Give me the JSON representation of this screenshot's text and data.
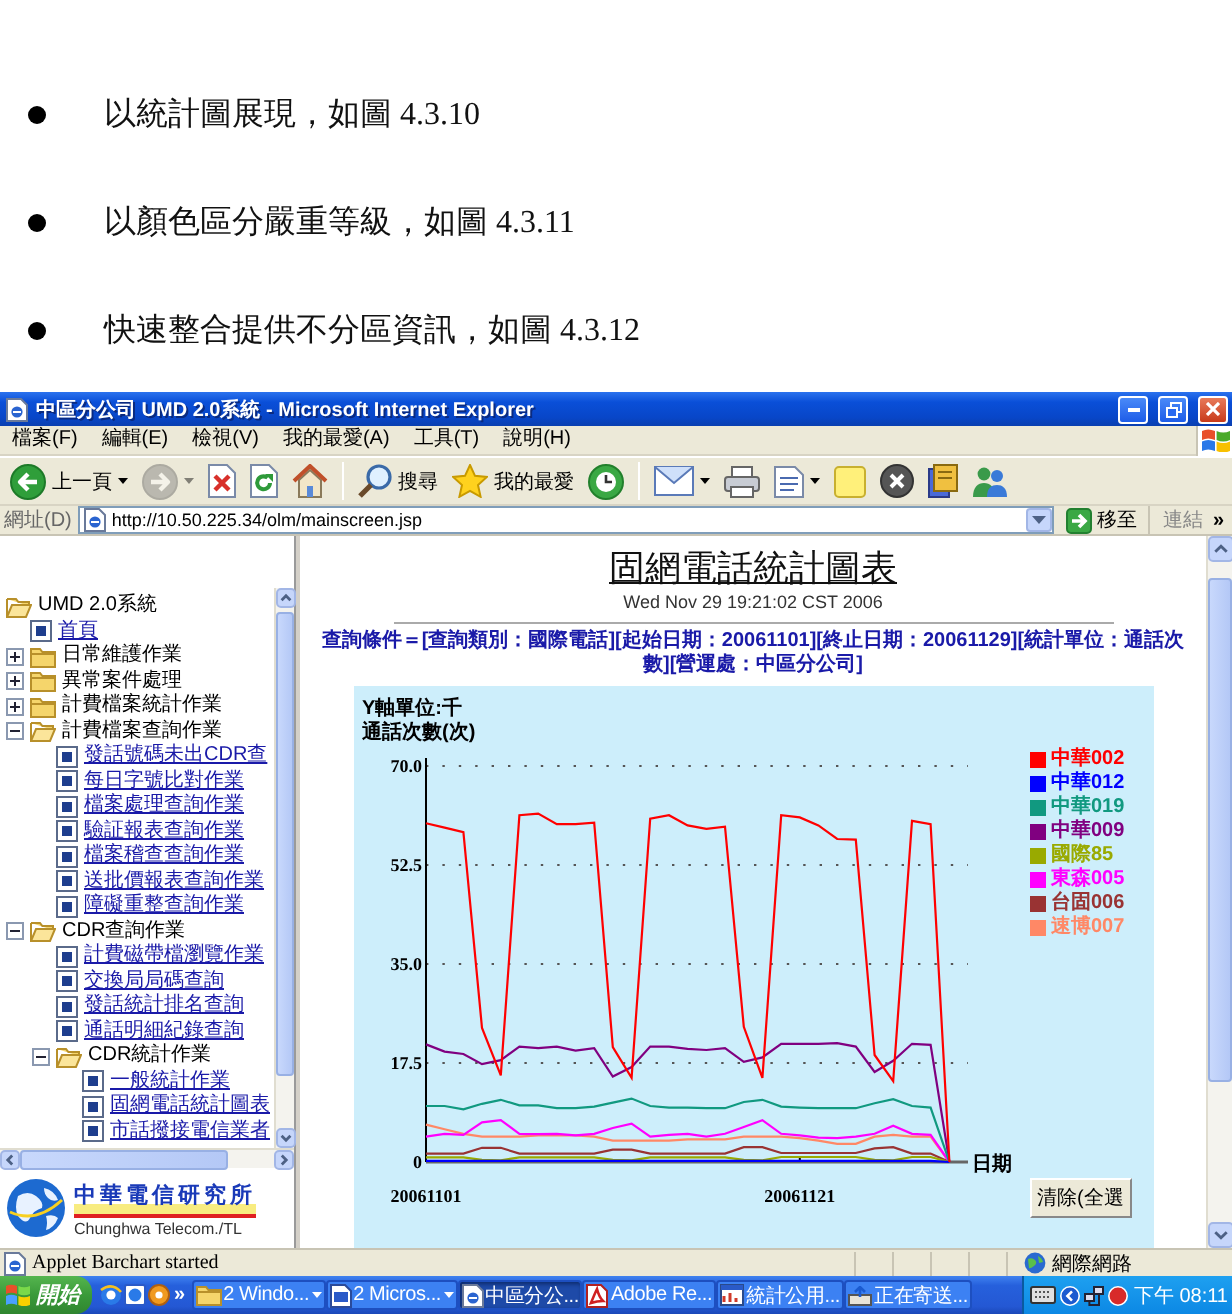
{
  "document": {
    "bullets": [
      "以統計圖展現，如圖 4.3.10",
      "以顏色區分嚴重等級，如圖 4.3.11",
      "快速整合提供不分區資訊，如圖 4.3.12"
    ]
  },
  "window": {
    "title": "中區分公司 UMD 2.0系統 - Microsoft Internet Explorer"
  },
  "menu": [
    "檔案(F)",
    "編輯(E)",
    "檢視(V)",
    "我的最愛(A)",
    "工具(T)",
    "說明(H)"
  ],
  "toolbar": {
    "groups": [
      [
        {
          "kind": "back",
          "label": "上一頁",
          "dropdown": true,
          "disabled": false
        },
        {
          "kind": "forward",
          "dropdown": true,
          "disabled": true
        },
        {
          "kind": "stop",
          "dropdown": false,
          "disabled": false
        },
        {
          "kind": "refresh",
          "dropdown": false,
          "disabled": false
        },
        {
          "kind": "home",
          "dropdown": false,
          "disabled": false
        }
      ],
      [
        {
          "kind": "search",
          "label": "搜尋",
          "dropdown": false,
          "disabled": false
        },
        {
          "kind": "favorites",
          "label": "我的最愛",
          "dropdown": false,
          "disabled": false
        },
        {
          "kind": "history",
          "dropdown": false,
          "disabled": false
        }
      ],
      [
        {
          "kind": "mail",
          "dropdown": true,
          "disabled": false
        },
        {
          "kind": "print",
          "dropdown": false,
          "disabled": false
        },
        {
          "kind": "edit",
          "dropdown": true,
          "disabled": false
        },
        {
          "kind": "note",
          "dropdown": false,
          "disabled": false
        },
        {
          "kind": "x-circle",
          "dropdown": false,
          "disabled": false
        },
        {
          "kind": "research",
          "dropdown": false,
          "disabled": false
        },
        {
          "kind": "messenger",
          "dropdown": false,
          "disabled": false
        }
      ]
    ]
  },
  "address_bar": {
    "label": "網址(D)",
    "url": "http://10.50.225.34/olm/mainscreen.jsp",
    "go": "移至",
    "links": "連結",
    "more": "»"
  },
  "sidebar": {
    "tree": [
      {
        "label": "UMD 2.0系統",
        "kind": "folder",
        "expanded": true,
        "children": [
          {
            "label": "首頁",
            "kind": "page"
          },
          {
            "label": "日常維護作業",
            "kind": "folder",
            "expanded": false
          },
          {
            "label": "異常案件處理",
            "kind": "folder",
            "expanded": false
          },
          {
            "label": "計費檔案統計作業",
            "kind": "folder",
            "expanded": false
          },
          {
            "label": "計費檔案查詢作業",
            "kind": "folder",
            "expanded": true,
            "children": [
              {
                "label": "發話號碼未出CDR查",
                "kind": "page"
              },
              {
                "label": "每日字號比對作業",
                "kind": "page"
              },
              {
                "label": "檔案處理查詢作業",
                "kind": "page"
              },
              {
                "label": "驗証報表查詢作業",
                "kind": "page"
              },
              {
                "label": "檔案稽查查詢作業",
                "kind": "page"
              },
              {
                "label": "送批價報表查詢作業",
                "kind": "page"
              },
              {
                "label": "障礙重整查詢作業",
                "kind": "page"
              }
            ]
          },
          {
            "label": "CDR查詢作業",
            "kind": "folder",
            "expanded": true,
            "children": [
              {
                "label": "計費磁帶檔瀏覽作業",
                "kind": "page"
              },
              {
                "label": "交換局局碼查詢",
                "kind": "page"
              },
              {
                "label": "發話統計排名查詢",
                "kind": "page"
              },
              {
                "label": "通話明細紀錄查詢",
                "kind": "page"
              },
              {
                "label": "CDR統計作業",
                "kind": "folder",
                "expanded": true,
                "children": [
                  {
                    "label": "一般統計作業",
                    "kind": "page"
                  },
                  {
                    "label": "固網電話統計圖表",
                    "kind": "page"
                  },
                  {
                    "label": "市話撥接電信業者",
                    "kind": "page"
                  }
                ]
              }
            ]
          }
        ]
      }
    ],
    "logo": {
      "name": "中華電信研究所",
      "subtitle": "Chunghwa Telecom./TL"
    }
  },
  "main": {
    "title": "固網電話統計圖表",
    "timestamp": "Wed Nov 29 19:21:02 CST 2006",
    "query": "查詢條件＝[查詢類別：國際電話][起始日期：20061101][終止日期：20061129][統計單位：通話次數][營運處：中區分公司]",
    "chart": {
      "unit_note": "Y軸單位:千",
      "clear_button": "清除(全選",
      "chart_data": {
        "type": "line",
        "xlabel": "日期",
        "ylabel": "通話次數(次)",
        "grid": true,
        "legend": true,
        "x": [
          20061101,
          20061102,
          20061103,
          20061104,
          20061105,
          20061106,
          20061107,
          20061108,
          20061109,
          20061110,
          20061111,
          20061112,
          20061113,
          20061114,
          20061115,
          20061116,
          20061117,
          20061118,
          20061119,
          20061120,
          20061121,
          20061122,
          20061123,
          20061124,
          20061125,
          20061126,
          20061127,
          20061128,
          20061129
        ],
        "xlim": [
          20061101,
          20061130
        ],
        "xticks": [
          20061101,
          20061121
        ],
        "ylim": [
          0,
          70
        ],
        "yticks": [
          {
            "value": 0,
            "label": "0"
          },
          {
            "value": 17.5,
            "label": "17.5"
          },
          {
            "value": 35,
            "label": "35.0"
          },
          {
            "value": 52.5,
            "label": "52.5"
          },
          {
            "value": 70,
            "label": "70.0"
          }
        ],
        "series": [
          {
            "name": "中華002",
            "color": "#ff0000",
            "values": [
              59.9,
              59.1,
              58.3,
              23.7,
              15.3,
              61.3,
              61.6,
              59.7,
              59.7,
              60.0,
              20.3,
              14.9,
              60.7,
              61.3,
              59.5,
              58.9,
              59.3,
              23.9,
              14.9,
              61.3,
              60.9,
              59.5,
              57.1,
              57.0,
              18.9,
              14.3,
              60.3,
              59.7,
              0
            ]
          },
          {
            "name": "中華012",
            "color": "#0000ff",
            "values": [
              0.2,
              0.2,
              0.2,
              0.2,
              0.2,
              0.2,
              0.2,
              0.2,
              0.2,
              0.2,
              0.2,
              0.2,
              0.2,
              0.2,
              0.2,
              0.2,
              0.2,
              0.2,
              0.2,
              0.2,
              0.2,
              0.2,
              0.2,
              0.2,
              0.2,
              0.2,
              0.2,
              0.2,
              0
            ]
          },
          {
            "name": "中華019",
            "color": "#119980",
            "values": [
              9.9,
              9.9,
              9.3,
              10.3,
              11.0,
              10.0,
              10.0,
              9.5,
              9.5,
              9.8,
              10.5,
              11.2,
              9.9,
              9.6,
              9.6,
              9.5,
              9.5,
              10.6,
              11.0,
              9.8,
              9.6,
              9.5,
              9.5,
              9.5,
              10.4,
              11.1,
              9.9,
              9.6,
              0
            ]
          },
          {
            "name": "中華009",
            "color": "#800080",
            "values": [
              20.8,
              19.5,
              19.1,
              17.3,
              18.0,
              20.4,
              20.1,
              20.4,
              19.7,
              20.1,
              15.1,
              16.8,
              20.4,
              20.4,
              20.0,
              19.8,
              20.1,
              17.7,
              18.5,
              20.9,
              20.9,
              20.9,
              21.0,
              20.4,
              15.9,
              17.9,
              20.9,
              20.7,
              0
            ]
          },
          {
            "name": "國際85",
            "color": "#99aa00",
            "values": [
              0.8,
              0.8,
              0.8,
              0.4,
              0.3,
              0.8,
              0.8,
              0.8,
              0.8,
              0.8,
              0.4,
              0.3,
              0.8,
              0.8,
              0.8,
              0.8,
              0.8,
              0.4,
              0.3,
              0.9,
              0.9,
              0.9,
              0.9,
              0.9,
              0.4,
              0.3,
              0.9,
              0.9,
              0
            ]
          },
          {
            "name": "東森005",
            "color": "#ff00ff",
            "values": [
              4.5,
              5.0,
              4.8,
              7.0,
              7.4,
              5.0,
              4.9,
              5.0,
              4.7,
              5.0,
              6.0,
              6.8,
              4.5,
              4.8,
              5.0,
              4.5,
              5.0,
              6.2,
              7.4,
              5.0,
              4.7,
              4.3,
              4.2,
              4.5,
              5.0,
              6.4,
              5.0,
              4.8,
              0
            ]
          },
          {
            "name": "台固006",
            "color": "#993333",
            "values": [
              1.5,
              1.5,
              1.5,
              2.5,
              2.5,
              1.5,
              1.5,
              1.5,
              1.5,
              1.5,
              2.2,
              2.2,
              1.5,
              1.5,
              1.5,
              1.5,
              1.5,
              2.6,
              2.6,
              1.6,
              1.6,
              1.6,
              1.6,
              1.6,
              2.4,
              2.6,
              1.5,
              1.5,
              0
            ]
          },
          {
            "name": "速博007",
            "color": "#ff8866",
            "values": [
              6.6,
              5.8,
              5.0,
              4.5,
              4.5,
              4.5,
              4.7,
              4.7,
              4.7,
              4.5,
              3.8,
              3.8,
              3.8,
              3.8,
              4.0,
              4.0,
              4.0,
              4.5,
              4.5,
              4.5,
              4.2,
              3.8,
              3.2,
              3.2,
              4.5,
              4.8,
              4.5,
              4.5,
              0
            ]
          }
        ]
      }
    }
  },
  "status_bar": {
    "text": "Applet Barchart started",
    "zone": "網際網路"
  },
  "taskbar": {
    "start": "開始",
    "quick_launch_more": "»",
    "tasks": [
      {
        "label": "2 Windo...",
        "kind": "folder",
        "grouped": true,
        "selected": false
      },
      {
        "label": "2 Micros...",
        "kind": "word",
        "grouped": true,
        "selected": false
      },
      {
        "label": "中區分公...",
        "kind": "browser",
        "grouped": false,
        "selected": true
      },
      {
        "label": "Adobe Re...",
        "kind": "pdf",
        "grouped": false,
        "selected": false
      },
      {
        "label": "統計公用...",
        "kind": "app",
        "grouped": false,
        "selected": false
      },
      {
        "label": "正在寄送...",
        "kind": "outbox",
        "grouped": false,
        "selected": false
      }
    ],
    "clock": "下午 08:11"
  }
}
